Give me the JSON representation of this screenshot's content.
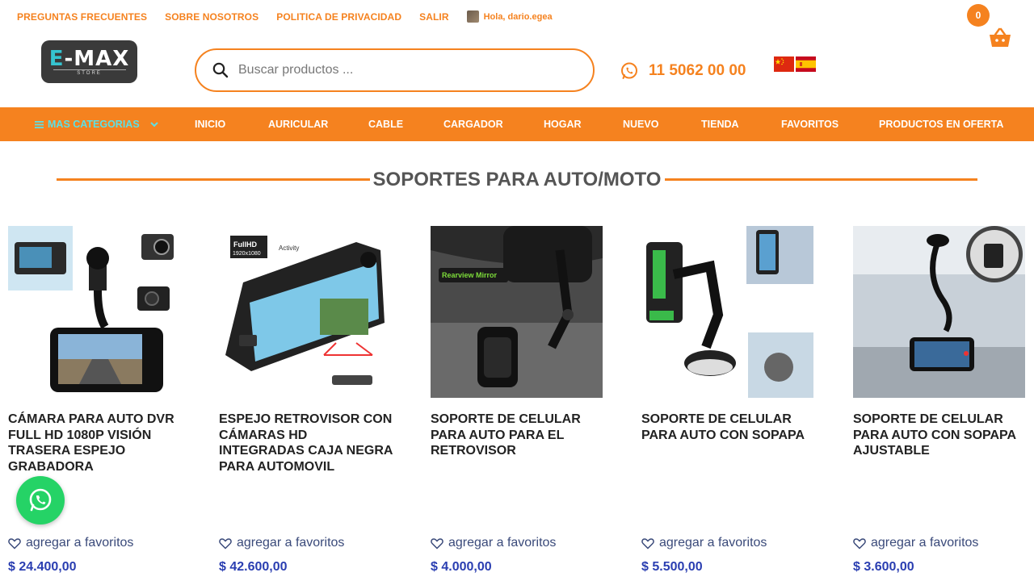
{
  "top_links": [
    "PREGUNTAS FRECUENTES",
    "SOBRE NOSOTROS",
    "POLITICA DE PRIVACIDAD",
    "SALIR"
  ],
  "user_greeting": "Hola, dario.egea",
  "cart_count": "0",
  "logo": {
    "main": "E-MAX",
    "sub": "STORE"
  },
  "search": {
    "placeholder": "Buscar productos ..."
  },
  "phone": "11 5062 00 00",
  "nav": {
    "categories_label": "MAS CATEGORIAS",
    "items": [
      "INICIO",
      "AURICULAR",
      "CABLE",
      "CARGADOR",
      "HOGAR",
      "NUEVO",
      "TIENDA",
      "FAVORITOS",
      "PRODUCTOS EN OFERTA"
    ]
  },
  "section_title": "SOPORTES PARA AUTO/MOTO",
  "fav_label": "agregar a favoritos",
  "products": [
    {
      "title": "CÁMARA PARA AUTO DVR FULL HD 1080P VISIÓN TRASERA ESPEJO GRABADORA",
      "price": "$ 24.400,00"
    },
    {
      "title": "ESPEJO RETROVISOR CON CÁMARAS HD INTEGRADAS CAJA NEGRA PARA AUTOMOVIL",
      "price": "$ 42.600,00",
      "img_text_1": "FullHD",
      "img_text_2": "1920x1080",
      "img_text_3": "Activity"
    },
    {
      "title": "SOPORTE DE CELULAR PARA AUTO PARA EL RETROVISOR",
      "price": "$ 4.000,00",
      "img_text": "Rearview Mirror"
    },
    {
      "title": "SOPORTE DE CELULAR PARA AUTO CON SOPAPA",
      "price": "$ 5.500,00"
    },
    {
      "title": "SOPORTE DE CELULAR PARA AUTO CON SOPAPA AJUSTABLE",
      "price": "$ 3.600,00"
    }
  ],
  "colors": {
    "accent": "#f5821f",
    "price": "#2a3eb1",
    "whatsapp": "#25d366",
    "category": "#5ce0e6"
  },
  "icons": [
    "search-icon",
    "whatsapp-icon",
    "cart-icon",
    "heart-icon",
    "menu-icon",
    "chevron-down-icon",
    "flag-china-icon",
    "flag-spain-icon"
  ]
}
